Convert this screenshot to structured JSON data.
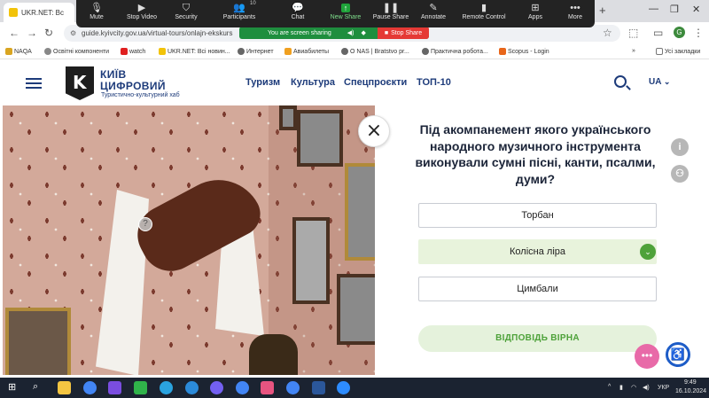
{
  "browser": {
    "tab_title": "UKR.NET: Вс",
    "url": "guide.kyivcity.gov.ua/virtual-tours/onlajn-ekskurs",
    "profile_initial": "G"
  },
  "screen_share": {
    "notice": "You are screen sharing",
    "stop_label": "Stop Share"
  },
  "zoom_toolbar": [
    {
      "label": "Mute",
      "icon": "microphone-icon"
    },
    {
      "label": "Stop Video",
      "icon": "video-camera-icon"
    },
    {
      "label": "Security",
      "icon": "shield-icon"
    },
    {
      "label": "Participants",
      "icon": "participants-icon",
      "badge": "10"
    },
    {
      "label": "Chat",
      "icon": "chat-bubble-icon"
    },
    {
      "label": "New Share",
      "icon": "share-arrow-icon"
    },
    {
      "label": "Pause Share",
      "icon": "pause-icon"
    },
    {
      "label": "Annotate",
      "icon": "pencil-icon"
    },
    {
      "label": "Remote Control",
      "icon": "mouse-icon"
    },
    {
      "label": "Apps",
      "icon": "apps-icon"
    },
    {
      "label": "More",
      "icon": "more-dots-icon"
    }
  ],
  "bookmarks": [
    "NAQA",
    "Освітні компоненти",
    "watch",
    "UKR.NET: Всі новин...",
    "Интернет",
    "Авиабилеты",
    "О NAS | Bratstvo pr...",
    "Практична робота...",
    "Scopus - Login"
  ],
  "bookmarks_extra": "Усі закладки",
  "site": {
    "logo_line1": "КИЇВ",
    "logo_line2": "ЦИФРОВИЙ",
    "logo_sub": "Туристично-культурний хаб",
    "nav": [
      "Туризм",
      "Культура",
      "Спецпроєкти",
      "ТОП-10"
    ],
    "lang": "UA"
  },
  "quiz": {
    "question": "Під акомпанемент якого українського  народного музичного інструмента виконували сумні пісні, канти, псалми, думи?",
    "answers": [
      "Торбан",
      "Колісна ліра",
      "Цимбали"
    ],
    "correct_index": 1,
    "result": "ВІДПОВІДЬ ВІРНА"
  },
  "taskbar": {
    "time": "9:49",
    "date": "16.10.2024",
    "lang": "УКР"
  },
  "colors": {
    "brand_blue": "#1d3b7a",
    "correct_green": "#4ea23a",
    "correct_bg": "#e8f3dc",
    "zoom_dark": "#232323",
    "share_green": "#1e8e3e",
    "stop_red": "#e53935"
  }
}
